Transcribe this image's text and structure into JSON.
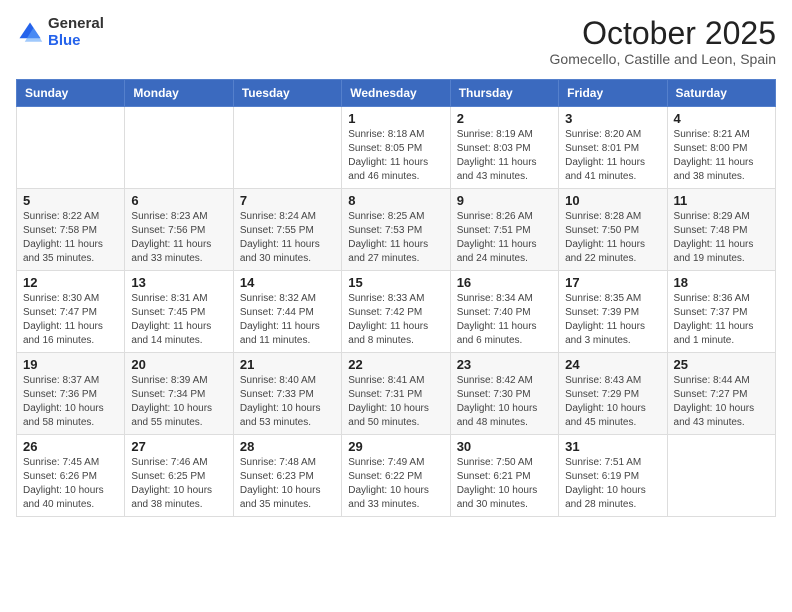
{
  "logo": {
    "general": "General",
    "blue": "Blue"
  },
  "title": "October 2025",
  "subtitle": "Gomecello, Castille and Leon, Spain",
  "weekdays": [
    "Sunday",
    "Monday",
    "Tuesday",
    "Wednesday",
    "Thursday",
    "Friday",
    "Saturday"
  ],
  "weeks": [
    [
      {
        "day": "",
        "info": ""
      },
      {
        "day": "",
        "info": ""
      },
      {
        "day": "",
        "info": ""
      },
      {
        "day": "1",
        "info": "Sunrise: 8:18 AM\nSunset: 8:05 PM\nDaylight: 11 hours and 46 minutes."
      },
      {
        "day": "2",
        "info": "Sunrise: 8:19 AM\nSunset: 8:03 PM\nDaylight: 11 hours and 43 minutes."
      },
      {
        "day": "3",
        "info": "Sunrise: 8:20 AM\nSunset: 8:01 PM\nDaylight: 11 hours and 41 minutes."
      },
      {
        "day": "4",
        "info": "Sunrise: 8:21 AM\nSunset: 8:00 PM\nDaylight: 11 hours and 38 minutes."
      }
    ],
    [
      {
        "day": "5",
        "info": "Sunrise: 8:22 AM\nSunset: 7:58 PM\nDaylight: 11 hours and 35 minutes."
      },
      {
        "day": "6",
        "info": "Sunrise: 8:23 AM\nSunset: 7:56 PM\nDaylight: 11 hours and 33 minutes."
      },
      {
        "day": "7",
        "info": "Sunrise: 8:24 AM\nSunset: 7:55 PM\nDaylight: 11 hours and 30 minutes."
      },
      {
        "day": "8",
        "info": "Sunrise: 8:25 AM\nSunset: 7:53 PM\nDaylight: 11 hours and 27 minutes."
      },
      {
        "day": "9",
        "info": "Sunrise: 8:26 AM\nSunset: 7:51 PM\nDaylight: 11 hours and 24 minutes."
      },
      {
        "day": "10",
        "info": "Sunrise: 8:28 AM\nSunset: 7:50 PM\nDaylight: 11 hours and 22 minutes."
      },
      {
        "day": "11",
        "info": "Sunrise: 8:29 AM\nSunset: 7:48 PM\nDaylight: 11 hours and 19 minutes."
      }
    ],
    [
      {
        "day": "12",
        "info": "Sunrise: 8:30 AM\nSunset: 7:47 PM\nDaylight: 11 hours and 16 minutes."
      },
      {
        "day": "13",
        "info": "Sunrise: 8:31 AM\nSunset: 7:45 PM\nDaylight: 11 hours and 14 minutes."
      },
      {
        "day": "14",
        "info": "Sunrise: 8:32 AM\nSunset: 7:44 PM\nDaylight: 11 hours and 11 minutes."
      },
      {
        "day": "15",
        "info": "Sunrise: 8:33 AM\nSunset: 7:42 PM\nDaylight: 11 hours and 8 minutes."
      },
      {
        "day": "16",
        "info": "Sunrise: 8:34 AM\nSunset: 7:40 PM\nDaylight: 11 hours and 6 minutes."
      },
      {
        "day": "17",
        "info": "Sunrise: 8:35 AM\nSunset: 7:39 PM\nDaylight: 11 hours and 3 minutes."
      },
      {
        "day": "18",
        "info": "Sunrise: 8:36 AM\nSunset: 7:37 PM\nDaylight: 11 hours and 1 minute."
      }
    ],
    [
      {
        "day": "19",
        "info": "Sunrise: 8:37 AM\nSunset: 7:36 PM\nDaylight: 10 hours and 58 minutes."
      },
      {
        "day": "20",
        "info": "Sunrise: 8:39 AM\nSunset: 7:34 PM\nDaylight: 10 hours and 55 minutes."
      },
      {
        "day": "21",
        "info": "Sunrise: 8:40 AM\nSunset: 7:33 PM\nDaylight: 10 hours and 53 minutes."
      },
      {
        "day": "22",
        "info": "Sunrise: 8:41 AM\nSunset: 7:31 PM\nDaylight: 10 hours and 50 minutes."
      },
      {
        "day": "23",
        "info": "Sunrise: 8:42 AM\nSunset: 7:30 PM\nDaylight: 10 hours and 48 minutes."
      },
      {
        "day": "24",
        "info": "Sunrise: 8:43 AM\nSunset: 7:29 PM\nDaylight: 10 hours and 45 minutes."
      },
      {
        "day": "25",
        "info": "Sunrise: 8:44 AM\nSunset: 7:27 PM\nDaylight: 10 hours and 43 minutes."
      }
    ],
    [
      {
        "day": "26",
        "info": "Sunrise: 7:45 AM\nSunset: 6:26 PM\nDaylight: 10 hours and 40 minutes."
      },
      {
        "day": "27",
        "info": "Sunrise: 7:46 AM\nSunset: 6:25 PM\nDaylight: 10 hours and 38 minutes."
      },
      {
        "day": "28",
        "info": "Sunrise: 7:48 AM\nSunset: 6:23 PM\nDaylight: 10 hours and 35 minutes."
      },
      {
        "day": "29",
        "info": "Sunrise: 7:49 AM\nSunset: 6:22 PM\nDaylight: 10 hours and 33 minutes."
      },
      {
        "day": "30",
        "info": "Sunrise: 7:50 AM\nSunset: 6:21 PM\nDaylight: 10 hours and 30 minutes."
      },
      {
        "day": "31",
        "info": "Sunrise: 7:51 AM\nSunset: 6:19 PM\nDaylight: 10 hours and 28 minutes."
      },
      {
        "day": "",
        "info": ""
      }
    ]
  ]
}
